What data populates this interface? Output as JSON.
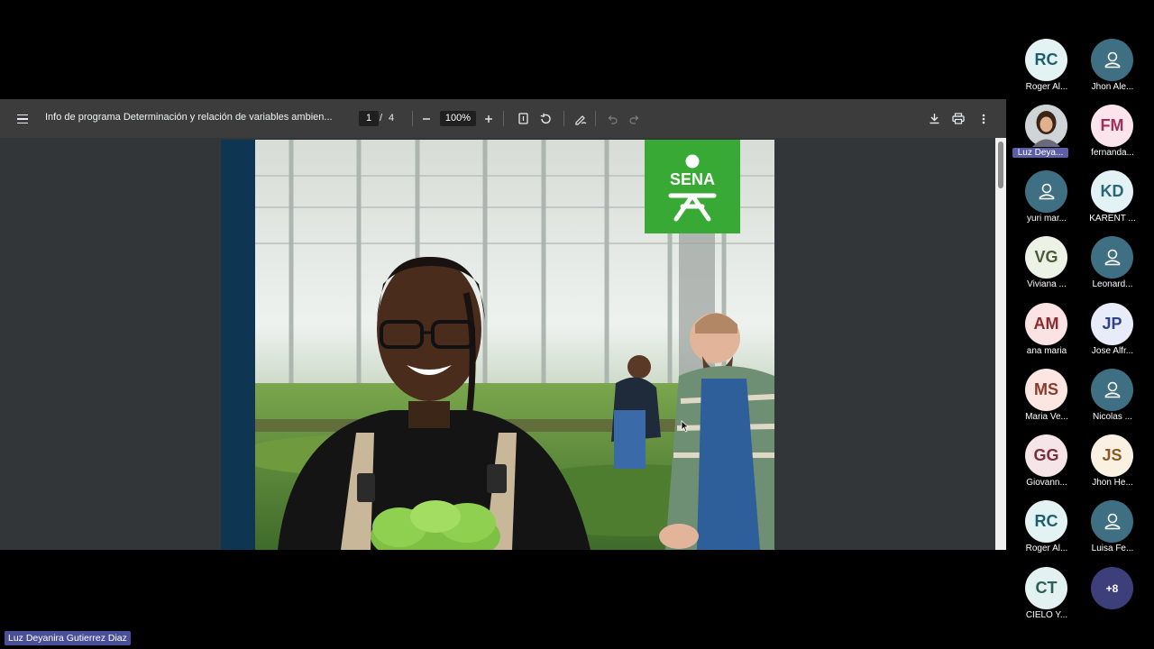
{
  "pdf": {
    "title": "Info de programa Determinación y relación de variables ambien...",
    "current_page": "1",
    "page_separator": "/",
    "total_pages": "4",
    "zoom": "100%",
    "logo_text": "SENA"
  },
  "participants": [
    {
      "initials": "RC",
      "name": "Roger Al...",
      "bg": "#e3f2f2",
      "fg": "#1f5f6b",
      "type": "initials"
    },
    {
      "initials": "",
      "name": "Jhon Ale...",
      "bg": "#3f6f82",
      "fg": "#ffffff",
      "type": "icon"
    },
    {
      "initials": "",
      "name": "Luz Deya...",
      "bg": "#6b6b6b",
      "fg": "#ffffff",
      "type": "photo",
      "highlight": true
    },
    {
      "initials": "FM",
      "name": "fernanda...",
      "bg": "#fbe4ec",
      "fg": "#a0305a",
      "type": "initials"
    },
    {
      "initials": "",
      "name": "yuri mar...",
      "bg": "#3f6f82",
      "fg": "#ffffff",
      "type": "icon"
    },
    {
      "initials": "KD",
      "name": "KARENT ...",
      "bg": "#e3f2f4",
      "fg": "#2a6677",
      "type": "initials"
    },
    {
      "initials": "VG",
      "name": "Viviana ...",
      "bg": "#edf2e6",
      "fg": "#4b5a3a",
      "type": "initials"
    },
    {
      "initials": "",
      "name": "Leonard...",
      "bg": "#3f6f82",
      "fg": "#ffffff",
      "type": "icon"
    },
    {
      "initials": "AM",
      "name": "ana maria",
      "bg": "#fbe3e3",
      "fg": "#8b2c2c",
      "type": "initials"
    },
    {
      "initials": "JP",
      "name": "Jose Alfr...",
      "bg": "#e8ecf8",
      "fg": "#30428a",
      "type": "initials"
    },
    {
      "initials": "MS",
      "name": "Maria Ve...",
      "bg": "#fbe6e2",
      "fg": "#8a3b2a",
      "type": "initials"
    },
    {
      "initials": "",
      "name": "Nicolas ...",
      "bg": "#3f6f82",
      "fg": "#ffffff",
      "type": "icon"
    },
    {
      "initials": "GG",
      "name": "Giovann...",
      "bg": "#f5e4e8",
      "fg": "#7b3041",
      "type": "initials"
    },
    {
      "initials": "JS",
      "name": "Jhon He...",
      "bg": "#fbf1e3",
      "fg": "#8a5a22",
      "type": "initials"
    },
    {
      "initials": "RC",
      "name": "Roger Al...",
      "bg": "#e3f2f2",
      "fg": "#1f5f6b",
      "type": "initials"
    },
    {
      "initials": "",
      "name": "Luisa  Fe...",
      "bg": "#3f6f82",
      "fg": "#ffffff",
      "type": "icon"
    },
    {
      "initials": "CT",
      "name": "CIELO Y...",
      "bg": "#e3f2f0",
      "fg": "#2a5f5a",
      "type": "initials"
    },
    {
      "initials": "+8",
      "name": "",
      "bg": "#3d3f7a",
      "fg": "#ffffff",
      "type": "more"
    }
  ],
  "presenter_label": "Luz Deyanira Gutierrez Diaz",
  "colors": {
    "toolbar": "#3c3c3c",
    "viewer_bg": "#323639",
    "sena_green": "#39a935",
    "highlight": "#5c5fa6"
  }
}
